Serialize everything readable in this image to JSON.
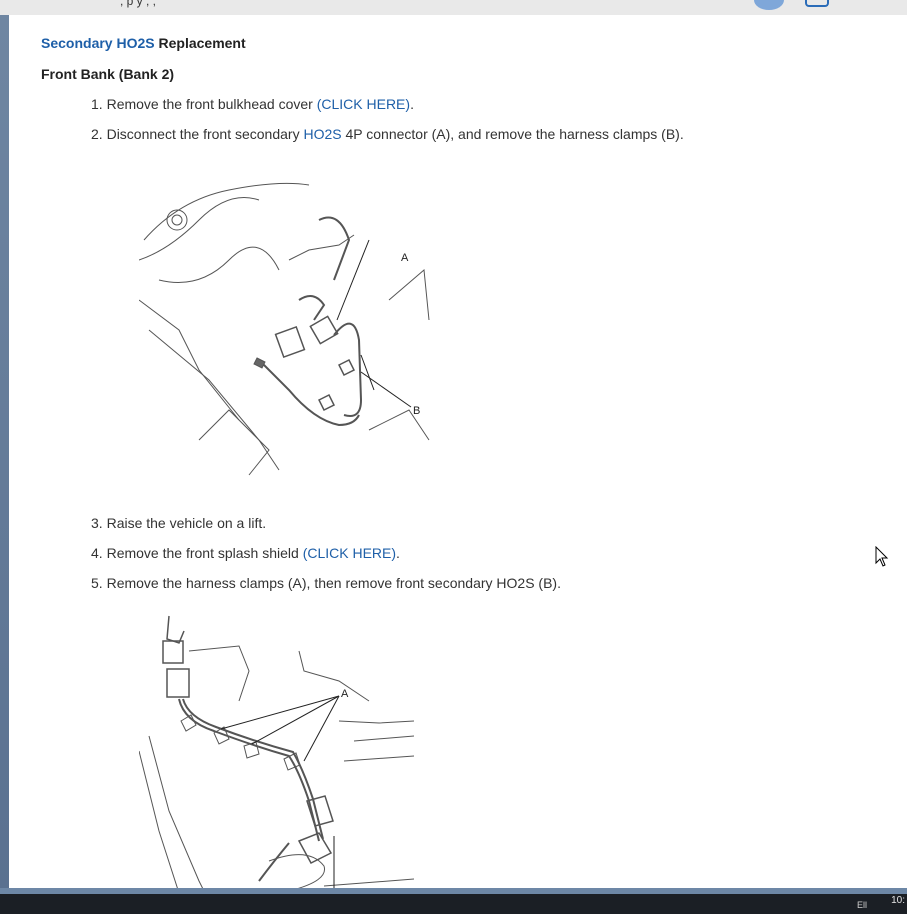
{
  "top_bar": {
    "fragment": ", p y ,  ,",
    "avatar_color": "#7fa7d9"
  },
  "heading": {
    "title_link": "Secondary HO2S",
    "title_rest": " Replacement",
    "subtitle": "Front Bank (Bank 2)"
  },
  "steps": [
    {
      "num": "1.",
      "pre": " Remove the front bulkhead cover ",
      "link": "(CLICK HERE)",
      "post": "."
    },
    {
      "num": "2.",
      "pre": " Disconnect the front secondary ",
      "link": "HO2S",
      "post": " 4P connector (A), and remove the harness clamps (B)."
    },
    {
      "num": "3.",
      "pre": " Raise the vehicle on a lift.",
      "link": "",
      "post": ""
    },
    {
      "num": "4.",
      "pre": " Remove the front splash shield ",
      "link": "(CLICK HERE)",
      "post": "."
    },
    {
      "num": "5.",
      "pre": " Remove the harness clamps (A), then remove front secondary HO2S (B).",
      "link": "",
      "post": ""
    }
  ],
  "figure1": {
    "label_a": "A",
    "label_b": "B"
  },
  "figure2": {
    "label_a": "A"
  },
  "taskbar": {
    "clock": "10:",
    "tray": "Ell"
  },
  "colors": {
    "link": "#1e5fa8",
    "text": "#333333",
    "frame": "#6d87a6",
    "taskbar": "#1b1f25"
  }
}
